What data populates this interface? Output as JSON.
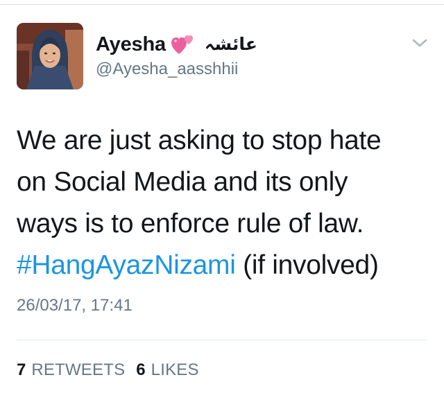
{
  "tweet": {
    "author": {
      "display_name": "Ayesha",
      "name_emoji": "two-hearts-icon",
      "arabic_name": "عائشہ",
      "handle": "@Ayesha_aasshhii"
    },
    "text_lines": [
      "We are just asking to stop hate",
      "on Social Media and its only",
      "ways is to enforce rule of law."
    ],
    "hashtag": "#HangAyazNizami",
    "text_suffix": "(if involved)",
    "timestamp": "26/03/17, 17:41",
    "stats": {
      "retweets_count": "7",
      "retweets_label": "RETWEETS",
      "likes_count": "6",
      "likes_label": "LIKES"
    }
  },
  "colors": {
    "text": "#14171a",
    "secondary_text": "#657786",
    "hashtag": "#1b95e0",
    "heart": "#f06ba8",
    "divider": "#e1e8ed"
  }
}
